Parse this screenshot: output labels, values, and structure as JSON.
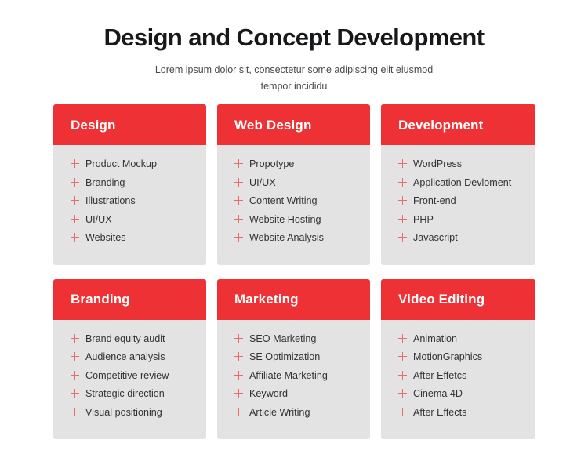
{
  "header": {
    "title": "Design and Concept Development",
    "subtitle": "Lorem ipsum dolor sit, consectetur some adipiscing elit eiusmod tempor incididu"
  },
  "colors": {
    "accent_red": "#EE3134",
    "plus_icon_red": "#EE6A65",
    "card_body_gray": "#E3E3E3",
    "page_background": "#FFFFFF",
    "title_text": "#17181A",
    "subtitle_text": "#4A4A4A",
    "list_text": "#333333"
  },
  "cards": [
    {
      "title": "Design",
      "items": [
        "Product Mockup",
        "Branding",
        "Illustrations",
        "UI/UX",
        "Websites"
      ]
    },
    {
      "title": "Web Design",
      "items": [
        "Propotype",
        "UI/UX",
        "Content Writing",
        "Website Hosting",
        "Website Analysis"
      ]
    },
    {
      "title": "Development",
      "items": [
        "WordPress",
        "Application Devloment",
        "Front-end",
        "PHP",
        "Javascript"
      ]
    },
    {
      "title": "Branding",
      "items": [
        "Brand equity audit",
        "Audience analysis",
        "Competitive review",
        "Strategic direction",
        "Visual positioning"
      ]
    },
    {
      "title": "Marketing",
      "items": [
        "SEO Marketing",
        "SE Optimization",
        "Affiliate Marketing",
        "Keyword",
        "Article Writing"
      ]
    },
    {
      "title": "Video Editing",
      "items": [
        "Animation",
        "MotionGraphics",
        "After Effetcs",
        "Cinema 4D",
        "After Effects"
      ]
    }
  ]
}
